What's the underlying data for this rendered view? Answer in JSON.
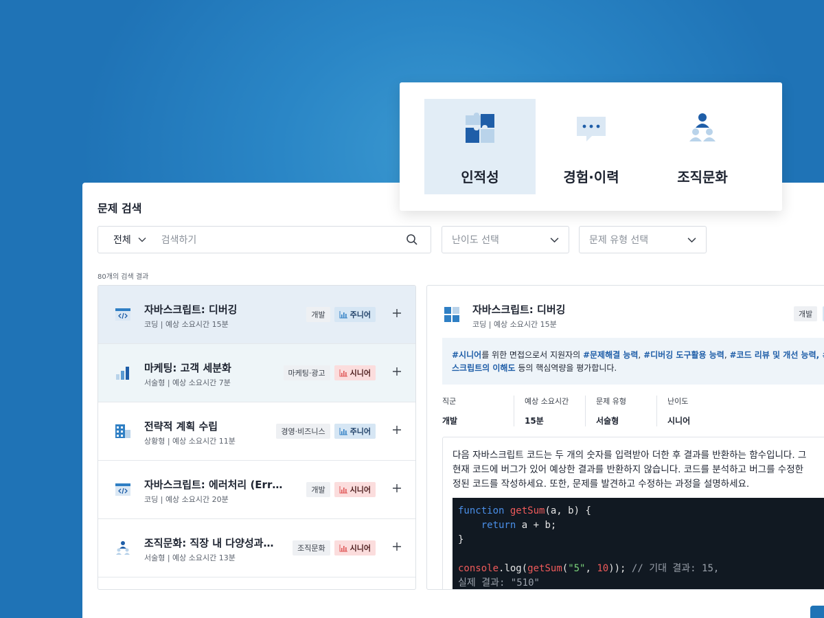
{
  "categories": [
    {
      "label": "인적성",
      "icon": "puzzle-icon"
    },
    {
      "label": "경험·이력",
      "icon": "chat-bubble-icon"
    },
    {
      "label": "조직문화",
      "icon": "people-group-icon"
    }
  ],
  "page": {
    "title": "문제 검색",
    "search": {
      "scope": "전체",
      "placeholder": "검색하기"
    },
    "difficulty_select": "난이도 선택",
    "type_select": "문제 유형 선택",
    "result_count": "80개의 검색 결과"
  },
  "list": [
    {
      "title": "자바스크립트: 디버깅",
      "sub": "코딩 | 예상 소요시간 15분",
      "tag": "개발",
      "level": "주니어",
      "level_kind": "junior",
      "icon": "code-window-icon"
    },
    {
      "title": "마케팅: 고객 세분화",
      "sub": "서술형 | 예상 소요시간 7분",
      "tag": "마케팅·광고",
      "level": "시니어",
      "level_kind": "senior",
      "icon": "bar-chart-icon"
    },
    {
      "title": "전략적 계획 수립",
      "sub": "상황형 | 예상 소요시간 11분",
      "tag": "경영·비즈니스",
      "level": "주니어",
      "level_kind": "junior",
      "icon": "building-icon"
    },
    {
      "title": "자바스크립트: 에러처리 (Error…",
      "sub": "코딩 | 예상 소요시간 20분",
      "tag": "개발",
      "level": "시니어",
      "level_kind": "senior",
      "icon": "code-window-icon"
    },
    {
      "title": "조직문화: 직장 내 다양성과…",
      "sub": "서술형 | 예상 소요시간 13분",
      "tag": "조직문화",
      "level": "시니어",
      "level_kind": "senior",
      "icon": "people-group-icon"
    }
  ],
  "detail": {
    "title": "자바스크립트: 디버깅",
    "sub": "코딩 | 예상 소요시간 15분",
    "tag": "개발",
    "summary": {
      "hl1": "#시니어",
      "t1": "를 위한 면접으로서 지원자의 ",
      "hl2": "#문제해결 능력",
      "t2": ", ",
      "hl3": "#디버깅 도구활용 능력",
      "t3": ", ",
      "hl4": "#코드 리뷰 및 개선 능력",
      "t4": ", #",
      "hl5": "스크립트의 이해도",
      "t5": " 등의 핵심역량을 평가합니다."
    },
    "meta": [
      {
        "label": "직군",
        "value": "개발"
      },
      {
        "label": "예상 소요시간",
        "value": "15분"
      },
      {
        "label": "문제 유형",
        "value": "서술형"
      },
      {
        "label": "난이도",
        "value": "시니어"
      }
    ],
    "question": [
      "다음 자바스크립트 코드는 두 개의 숫자를 입력받아 더한 후 결과를 반환하는 함수입니다. 그",
      "현재 코드에 버그가 있어 예상한 결과를 반환하지 않습니다. 코드를 분석하고 버그를 수정한",
      "정된 코드를 작성하세요. 또한, 문제를 발견하고 수정하는 과정을 설명하세요."
    ],
    "code": {
      "kw_function": "function",
      "fn_name": "getSum",
      "params": "(a, b) {",
      "kw_return": "return",
      "ret_expr": " a + b;",
      "close": "}",
      "console": "console",
      "dot_log": ".log(",
      "call": "getSum",
      "open": "(",
      "str": "\"5\"",
      "comma": ", ",
      "num": "10",
      "end": "));",
      "comment1": " // 기대 결과: 15,",
      "comment2": "실제 결과: \"510\""
    }
  }
}
